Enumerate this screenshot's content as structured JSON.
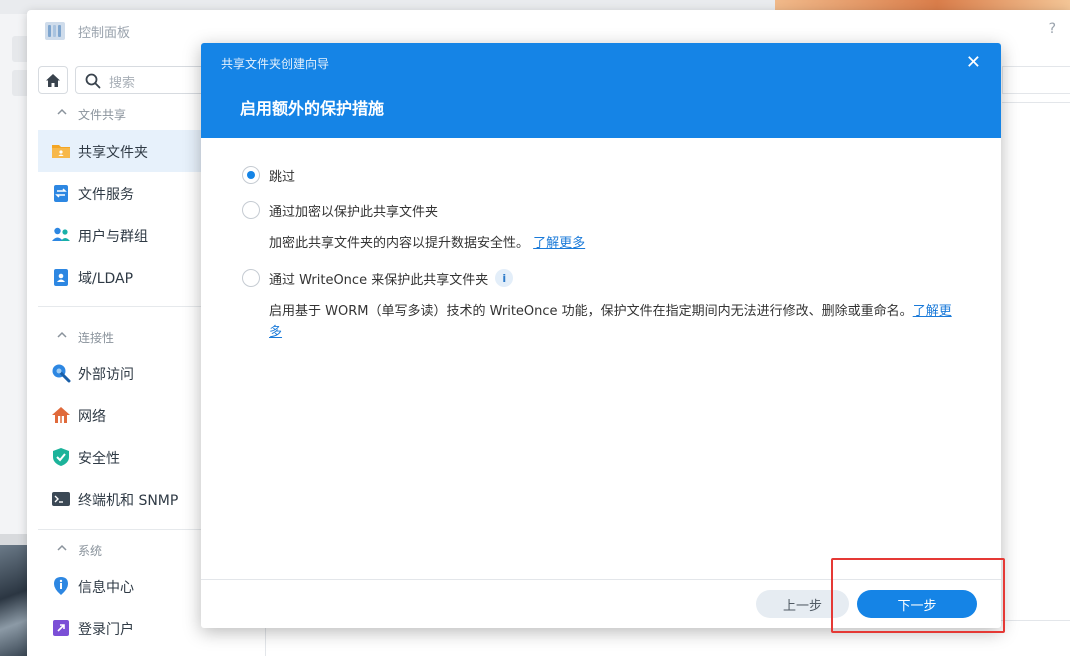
{
  "control_panel": {
    "title": "控制面板",
    "help_label": "?",
    "search_placeholder": "搜索",
    "sections": [
      {
        "label": "文件共享",
        "items": [
          {
            "label": "共享文件夹",
            "icon": "folder-share-icon",
            "active": true
          },
          {
            "label": "文件服务",
            "icon": "file-services-icon"
          },
          {
            "label": "用户与群组",
            "icon": "users-groups-icon"
          },
          {
            "label": "域/LDAP",
            "icon": "domain-ldap-icon"
          }
        ]
      },
      {
        "label": "连接性",
        "items": [
          {
            "label": "外部访问",
            "icon": "external-access-icon"
          },
          {
            "label": "网络",
            "icon": "network-icon"
          },
          {
            "label": "安全性",
            "icon": "security-shield-icon"
          },
          {
            "label": "终端机和 SNMP",
            "icon": "terminal-snmp-icon"
          }
        ]
      },
      {
        "label": "系统",
        "items": [
          {
            "label": "信息中心",
            "icon": "info-center-icon"
          },
          {
            "label": "登录门户",
            "icon": "login-portal-icon"
          }
        ]
      }
    ]
  },
  "wizard": {
    "window_title": "共享文件夹创建向导",
    "close_label": "✕",
    "step_title": "启用额外的保护措施",
    "options": [
      {
        "label": "跳过",
        "checked": true
      },
      {
        "label": "通过加密以保护此共享文件夹",
        "checked": false,
        "description": "加密此共享文件夹的内容以提升数据安全性。",
        "link": "了解更多"
      },
      {
        "label": "通过 WriteOnce 来保护此共享文件夹",
        "checked": false,
        "info_label": "i",
        "description": "启用基于 WORM（单写多读）技术的 WriteOnce 功能，保护文件在指定期间内无法进行修改、删除或重命名。",
        "link": "了解更多"
      }
    ],
    "buttons": {
      "prev": "上一步",
      "next": "下一步"
    }
  },
  "colors": {
    "accent": "#1584e6",
    "highlight_box": "#e53935"
  }
}
